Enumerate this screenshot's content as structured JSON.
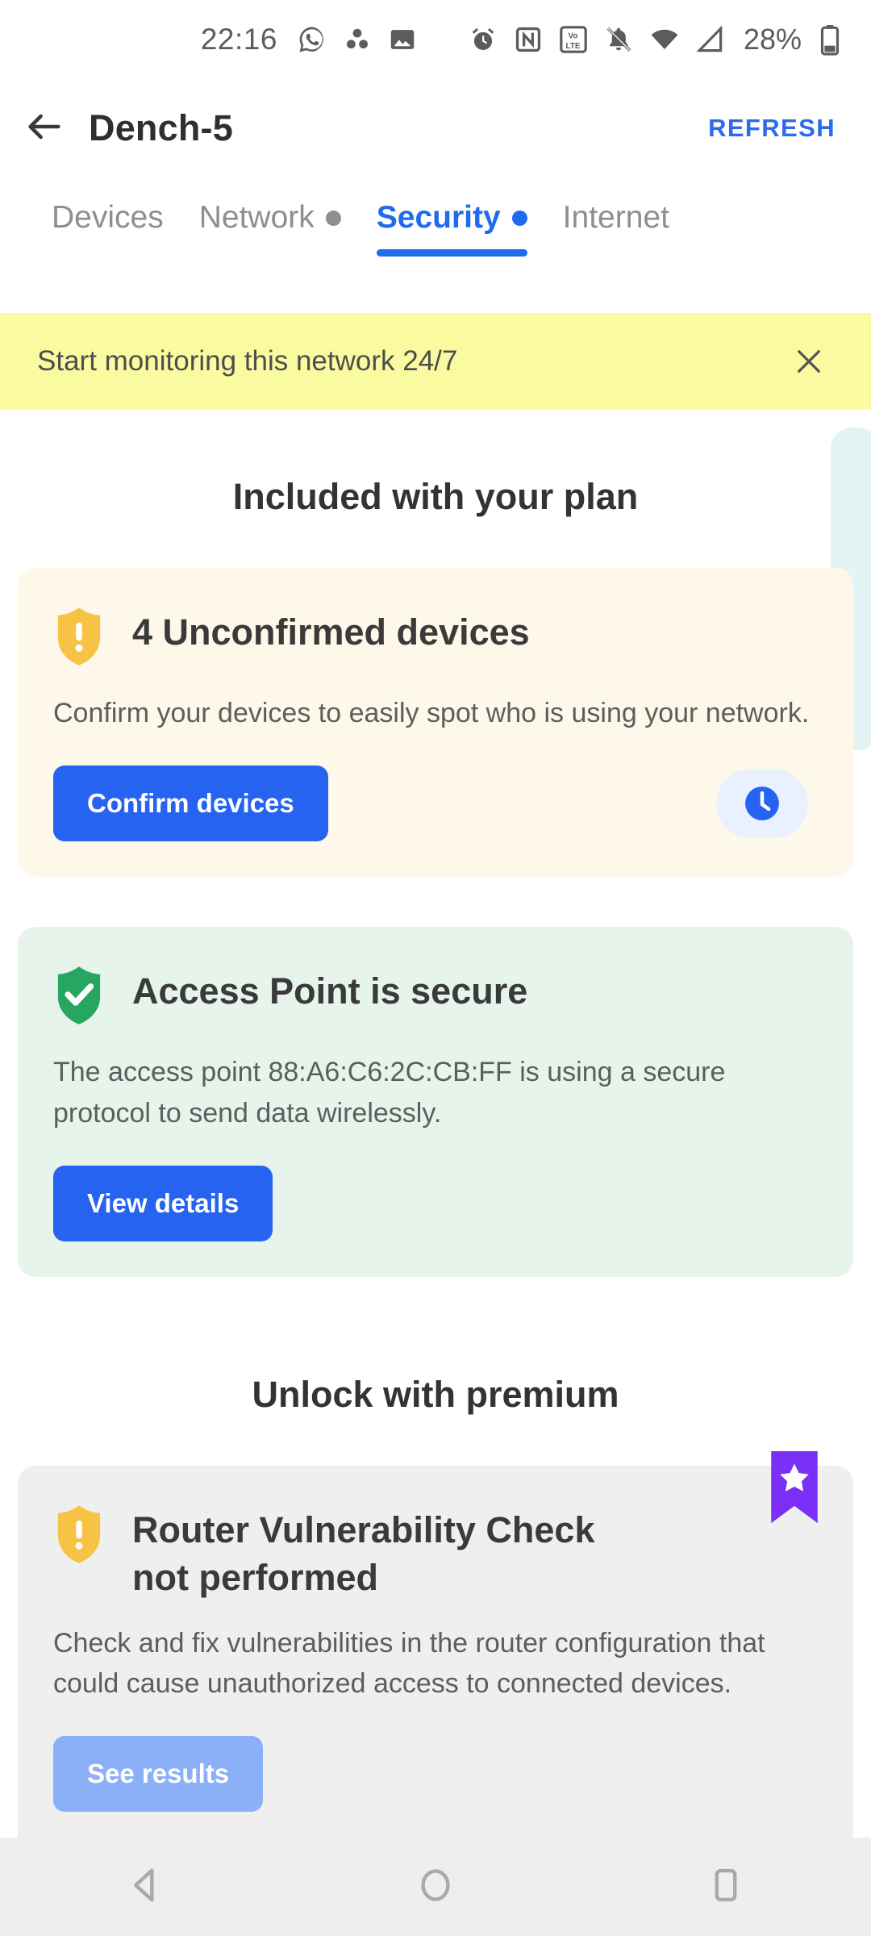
{
  "status_bar": {
    "time": "22:16",
    "battery_percent": "28%",
    "icons": [
      "whatsapp-icon",
      "cluster-dots-icon",
      "gallery-image-icon",
      "alarm-clock-icon",
      "nfc-icon",
      "volte-icon",
      "mute-bell-icon",
      "wifi-icon",
      "cellular-signal-icon",
      "battery-icon"
    ]
  },
  "app_bar": {
    "back_icon": "back-arrow-icon",
    "title": "Dench-5",
    "refresh_label": "REFRESH"
  },
  "tabs": [
    {
      "label": "Devices",
      "dot": "none",
      "active": false
    },
    {
      "label": "Network",
      "dot": "gray",
      "active": false
    },
    {
      "label": "Security",
      "dot": "blue",
      "active": true
    },
    {
      "label": "Internet",
      "dot": "none",
      "active": false
    }
  ],
  "banner": {
    "text": "Start monitoring this network 24/7",
    "close_icon": "close-icon",
    "background": "#fafaa0"
  },
  "sections": {
    "included_title": "Included with your plan",
    "premium_title": "Unlock with premium"
  },
  "cards": {
    "unconfirmed_devices": {
      "icon": "warning-shield-icon",
      "title": "4 Unconfirmed devices",
      "description": "Confirm your devices to easily spot who is using your network.",
      "button_label": "Confirm devices",
      "side_icon": "clock-icon",
      "background": "#fdf8ea",
      "accent": "#f6c344"
    },
    "access_point_secure": {
      "icon": "check-shield-icon",
      "title": "Access Point is secure",
      "description": "The access point 88:A6:C6:2C:CB:FF is using a secure protocol to send data wirelessly.",
      "button_label": "View details",
      "background": "#e6f4ec",
      "accent": "#27a662"
    },
    "router_vulnerability": {
      "icon": "warning-shield-icon",
      "badge_icon": "premium-star-ribbon-icon",
      "title": "Router Vulnerability Check not performed",
      "description": "Check and fix vulnerabilities in the router configuration that could cause unauthorized access to connected devices.",
      "button_label": "See results",
      "background": "#efefef",
      "accent": "#f6c344",
      "badge_color": "#7b2ff7"
    }
  },
  "nav_bar": {
    "back": "nav-back-icon",
    "home": "nav-home-icon",
    "recents": "nav-recents-icon"
  },
  "colors": {
    "primary_blue": "#2563f0",
    "tab_blue": "#1f6bf0",
    "refresh_blue": "#2c6bed"
  }
}
